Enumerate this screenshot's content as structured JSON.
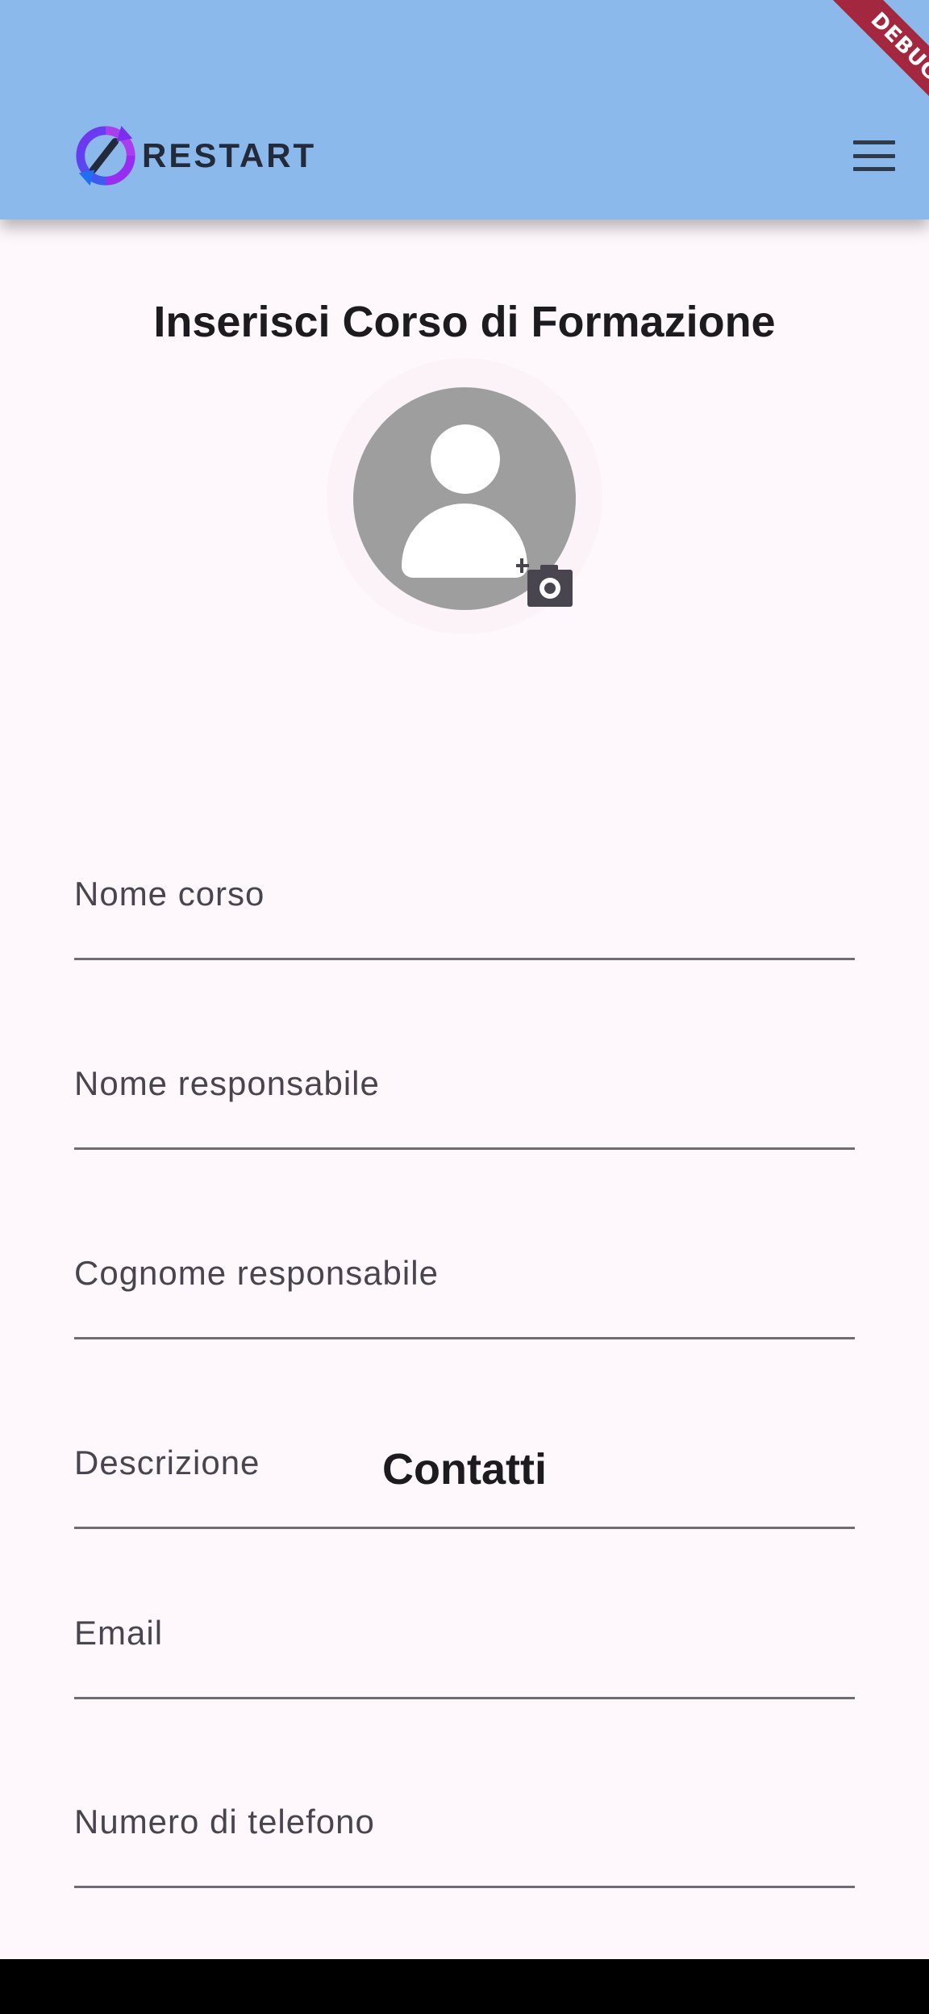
{
  "app_bar": {
    "logo_text": "RESTART",
    "logo_icon": "restart-sync-icon",
    "menu_icon": "hamburger-menu-icon",
    "background_color": "#8bb9ec"
  },
  "debug_banner": {
    "label": "DEBUG",
    "color": "#a3273f"
  },
  "form": {
    "title": "Inserisci Corso di Formazione",
    "avatar_icon": "person-placeholder-icon",
    "camera_icon": "add-photo-camera-icon",
    "fields": [
      {
        "label": "Nome corso",
        "value": ""
      },
      {
        "label": "Nome responsabile",
        "value": ""
      },
      {
        "label": "Cognome responsabile",
        "value": ""
      },
      {
        "label": "Descrizione",
        "value": ""
      }
    ],
    "contacts_title": "Contatti",
    "contact_fields": [
      {
        "label": "Email",
        "value": ""
      },
      {
        "label": "Numero di telefono",
        "value": ""
      }
    ]
  }
}
